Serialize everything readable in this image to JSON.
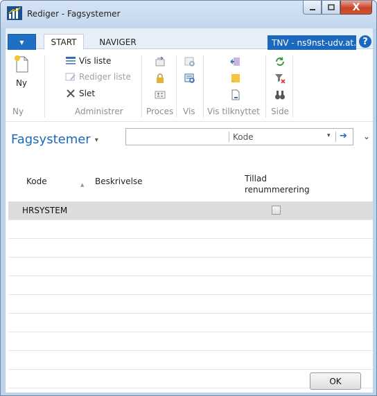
{
  "window": {
    "title": "Rediger - Fagsystemer",
    "minimize": "—",
    "maximize": "□",
    "close": "X"
  },
  "ribbon_tabs": {
    "menu": "▼",
    "start": "START",
    "navigate": "NAVIGER",
    "company": "TNV - ns9nst-udv.at...",
    "help": "?"
  },
  "ribbon": {
    "new_label": "Ny",
    "show_list": "Vis liste",
    "edit_list": "Rediger liste",
    "delete": "Slet",
    "groups": {
      "new": "Ny",
      "manage": "Administrer",
      "process": "Proces",
      "view": "Vis",
      "show_attached": "Vis tilknyttet",
      "page": "Side"
    }
  },
  "page": {
    "title": "Fagsystemer",
    "caret": "▾",
    "filter_value": "",
    "filter_field": "Kode",
    "filter_dropdown": "▾",
    "filter_go": "➔",
    "collapse": "⌄"
  },
  "table": {
    "headers": {
      "code": "Kode",
      "sort_arrow": "▲",
      "description": "Beskrivelse",
      "allow_renumber": "Tillad",
      "allow_renumber_2": "renummerering"
    },
    "rows": [
      {
        "code": "HRSYSTEM",
        "description": "",
        "checked": false
      }
    ]
  },
  "footer": {
    "ok": "OK"
  },
  "colors": {
    "accent": "#1a69be",
    "selected_row": "#dcdcdc"
  }
}
